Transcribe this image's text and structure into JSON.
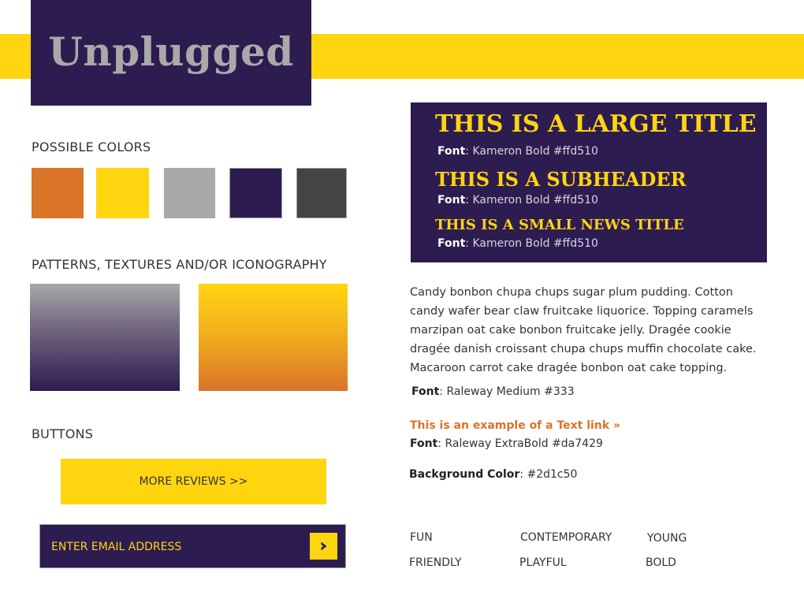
{
  "header": {
    "logo_text": "Unplugged"
  },
  "colors": {
    "heading": "POSSIBLE COLORS",
    "swatches": [
      {
        "name": "orange",
        "hex": "#da7429"
      },
      {
        "name": "yellow",
        "hex": "#ffd510"
      },
      {
        "name": "gray",
        "hex": "#a9a9a9"
      },
      {
        "name": "purple",
        "hex": "#2d1c50"
      },
      {
        "name": "dark-gray",
        "hex": "#444444"
      }
    ]
  },
  "patterns": {
    "heading": "PATTERNS, TEXTURES AND/OR ICONOGRAPHY"
  },
  "buttons": {
    "heading": "BUTTONS",
    "more_reviews_label": "MORE REVIEWS >>",
    "email_placeholder": "ENTER EMAIL ADDRESS",
    "submit_icon": "chevron-right-icon"
  },
  "typography": {
    "large_title": "THIS IS A LARGE TITLE",
    "subheader": "THIS IS A SUBHEADER",
    "small_title": "THIS IS A SMALL NEWS TITLE",
    "font_label": "Font",
    "font_spec": ": Kameron Bold #ffd510"
  },
  "body_copy": {
    "text": "Candy bonbon chupa chups sugar plum pudding. Cotton candy wafer bear claw fruitcake liquorice. Topping caramels marzipan oat cake bonbon fruitcake jelly. Dragée cookie dragée danish croissant chupa chups muffin chocolate cake. Macaroon carrot cake dragée bonbon oat cake topping.",
    "font_label": "Font",
    "font_spec": ": Raleway Medium #333"
  },
  "text_link": {
    "label": "This is an example of a Text link »",
    "font_label": "Font",
    "font_spec": ": Raleway ExtraBold #da7429"
  },
  "background": {
    "label": "Background Color",
    "value": ": #2d1c50"
  },
  "keywords": [
    "FUN",
    "CONTEMPORARY",
    "YOUNG",
    "FRIENDLY",
    "PLAYFUL",
    "BOLD"
  ]
}
